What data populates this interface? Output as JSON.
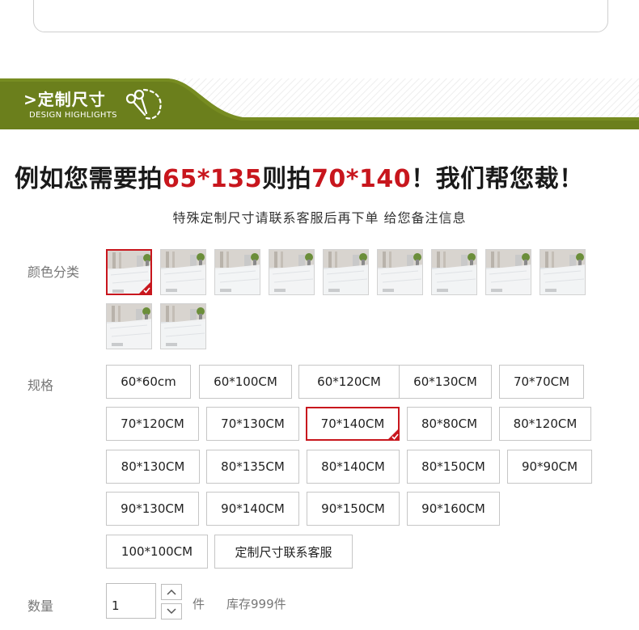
{
  "banner": {
    "title": ">定制尺寸",
    "subtitle": "DESIGN HIGHLIGHTS"
  },
  "headline": {
    "part1": "例如您需要拍",
    "size1": "65*135",
    "part2": "则拍",
    "size2": "70*140",
    "part3": "！我们帮您裁！"
  },
  "subline": "特殊定制尺寸请联系客服后再下单 给您备注信息",
  "color_label": "颜色分类",
  "spec_label": "规格",
  "spec_options": [
    "60*60cm",
    "60*100CM",
    "60*120CM",
    "60*130CM",
    "70*70CM",
    "70*120CM",
    "70*130CM",
    "70*140CM",
    "80*80CM",
    "80*120CM",
    "80*130CM",
    "80*135CM",
    "80*140CM",
    "80*150CM",
    "90*90CM",
    "90*130CM",
    "90*140CM",
    "90*150CM",
    "90*160CM",
    "100*100CM",
    "定制尺寸联系客服"
  ],
  "selected_spec": "70*140CM",
  "quantity": {
    "label": "数量",
    "value": "1",
    "unit": "件",
    "stock": "库存999件"
  },
  "colors": {
    "accent": "#c8161d",
    "banner_green": "#6b7f1c"
  }
}
